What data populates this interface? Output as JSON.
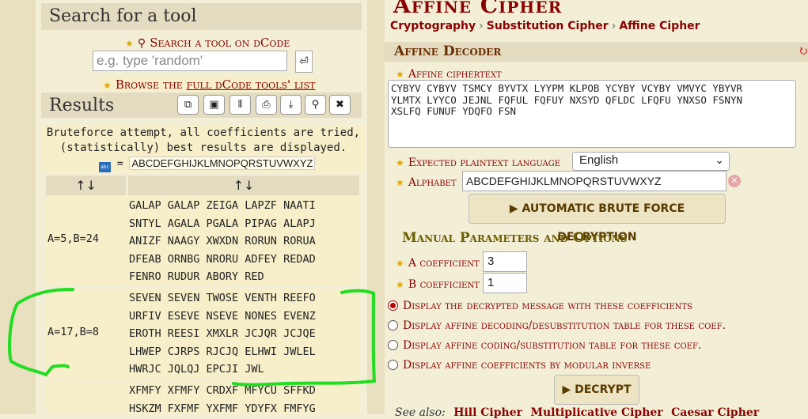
{
  "search": {
    "title": "Search for a tool",
    "link": "Search a tool on dCode",
    "placeholder": "e.g. type 'random'",
    "enter_icon": "⏎",
    "browse_prefix": "Browse the ",
    "browse_link": "full dCode tools' list"
  },
  "results": {
    "title": "Results",
    "toolbar": [
      "⧉",
      "▣",
      "⦀",
      "⎙",
      "⤓",
      "⚲",
      "✖"
    ],
    "intro_line1": "Bruteforce attempt, all coefficients are tried,",
    "intro_line2": "(statistically) best results are displayed.",
    "alphabet_eq": "=",
    "alphabet": "ABCDEFGHIJKLMNOPQRSTUVWXYZ",
    "col_headers": [
      "↑↓",
      "↑↓"
    ],
    "rows": [
      {
        "label": "A=5,B=24",
        "lines": [
          "GALAP GALAP ZEIGA LAPZF NAATI",
          "SNTYL AGALA PGALA PIPAG ALAPJ",
          "ANIZF NAAGY XWXDN RORUN RORUA",
          "DFEAB ORNBG NRORU ADFEY REDAD",
          "FENRO RUDUR ABORY RED"
        ]
      },
      {
        "label": "A=17,B=8",
        "lines": [
          "SEVEN SEVEN TWOSE VENTH REEFO",
          "URFIV ESEVE NSEVE NONES EVENZ",
          "EROTH REESI XMXLR JCJQR JCJQE",
          "LHWEP CJRPS RJCJQ ELHWI JWLEL",
          "HWRJC JQLQJ EPCJI JWL"
        ]
      },
      {
        "label": "",
        "lines": [
          "XFMFY XFMFY CRDXF MFYCU SFFKD",
          "HSKZM FXFMF YXFMF YDYFX FMFYG"
        ]
      }
    ]
  },
  "cipher": {
    "title": "Affine Cipher",
    "breadcrumbs": [
      "Cryptography",
      "Substitution Cipher",
      "Affine Cipher"
    ],
    "decoder_title": "Affine Decoder",
    "ciphertext_label": "Affine ciphertext",
    "ciphertext_lines": [
      "CYBYV CYBYV TSMCY BYVTX LYYPM KLPOB YCYBY VCYBY VMVYC YBYVR",
      "YLMTX LYYCO JEJNL FQFUL FQFUY NXSYD QFLDC LFQFU YNXSO FSNYN",
      "XSLFQ FUNUF YDQFO FSN"
    ],
    "language_label": "Expected plaintext language",
    "language_value": "English",
    "alphabet_label": "Alphabet",
    "alphabet_value": "ABCDEFGHIJKLMNOPQRSTUVWXYZ",
    "brute_button": "Automatic Brute Force Decryption",
    "manual_title": "Manual Parameters and Options",
    "a_label": "A coefficient",
    "a_value": "3",
    "b_label": "B coefficient",
    "b_value": "1",
    "options": [
      "Display the decrypted message with these coefficients",
      "Display affine decoding/desubstitution table for these coef.",
      "Display affine coding/substitution table for these coef.",
      "Display affine coefficients by modular inverse"
    ],
    "decrypt_button": "Decrypt",
    "see_also_label": "See also:",
    "see_also": [
      "Hill Cipher",
      "Multiplicative Cipher",
      "Caesar Cipher"
    ]
  },
  "colors": {
    "accent": "#8b0000",
    "highlight": "#22dd22",
    "panel": "#f3efd7"
  }
}
